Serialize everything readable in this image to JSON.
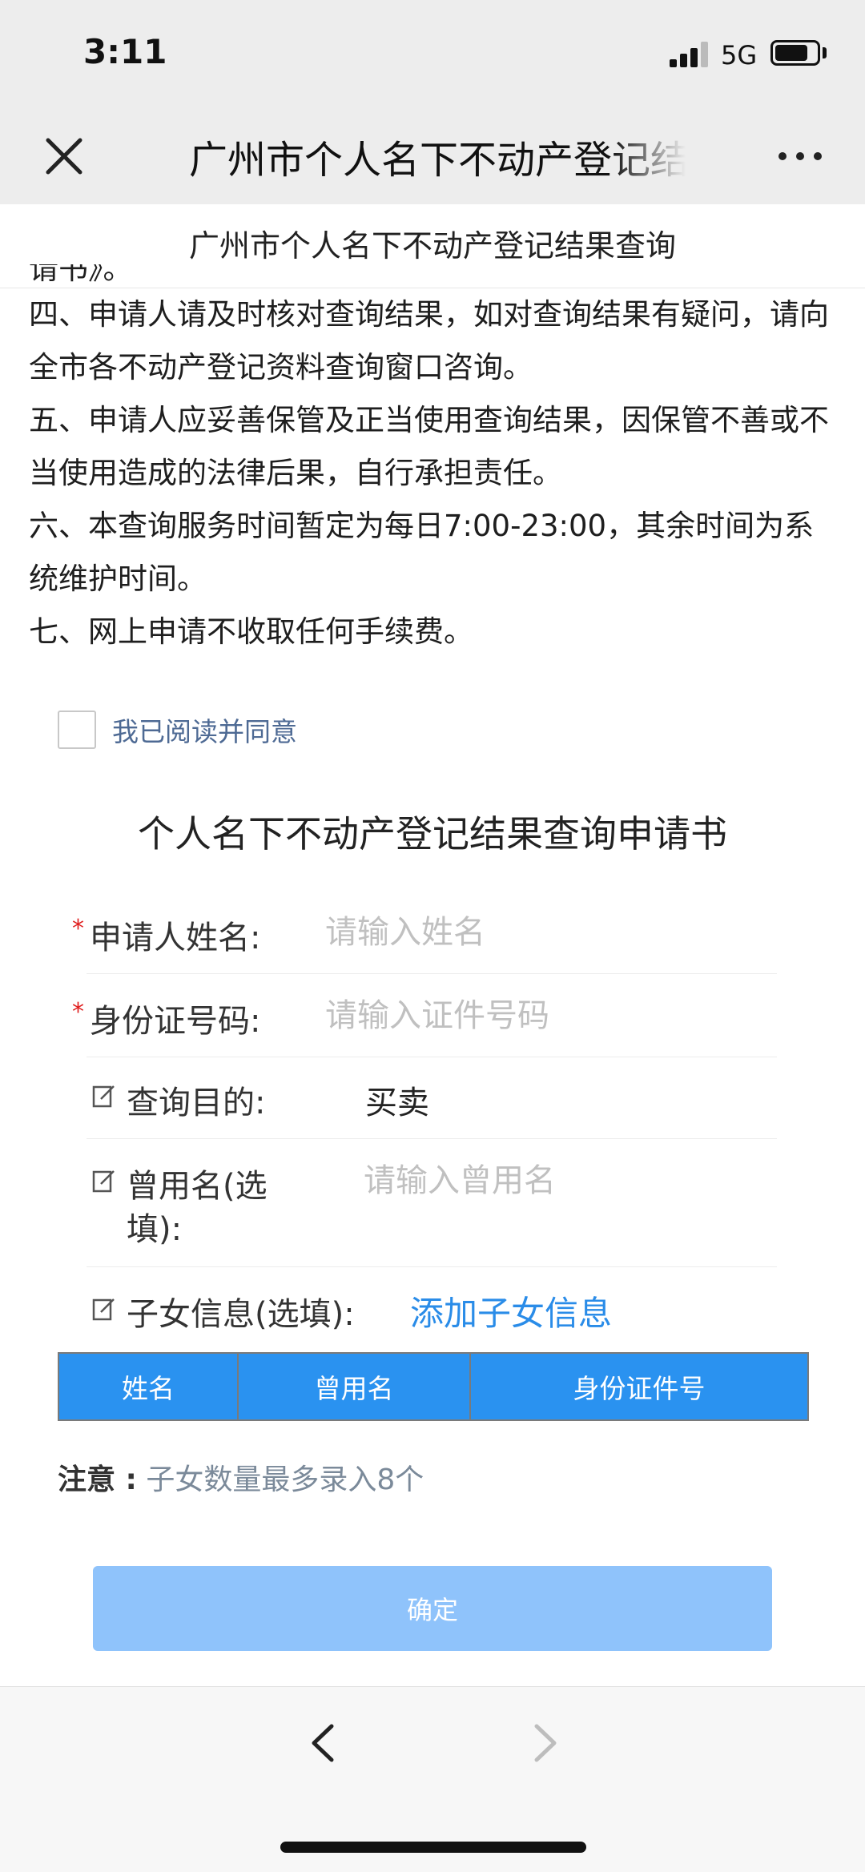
{
  "status_bar": {
    "time": "3:11",
    "network": "5G",
    "signal_level": 0.75,
    "battery_level": 0.8
  },
  "nav": {
    "close_icon": "close-icon",
    "title": "广州市个人名下不动产登记结",
    "more_icon": "more-icon"
  },
  "page_header": {
    "title": "广州市个人名下不动产登记结果查询"
  },
  "notice": {
    "cut_line": "请书》。",
    "items": [
      "四、申请人请及时核对查询结果，如对查询结果有疑问，请向全市各不动产登记资料查询窗口咨询。",
      "五、申请人应妥善保管及正当使用查询结果，因保管不善或不当使用造成的法律后果，自行承担责任。",
      "六、本查询服务时间暂定为每日7:00-23:00，其余时间为系统维护时间。",
      "七、网上申请不收取任何手续费。"
    ]
  },
  "agreement": {
    "label": "我已阅读并同意",
    "checked": false
  },
  "form": {
    "title": "个人名下不动产登记结果查询申请书",
    "required_mark": "*",
    "name": {
      "label": "申请人姓名:",
      "placeholder": "请输入姓名",
      "value": ""
    },
    "id_number": {
      "label": "身份证号码:",
      "placeholder": "请输入证件号码",
      "value": ""
    },
    "purpose": {
      "label": "查询目的:",
      "value": "买卖"
    },
    "former_name": {
      "label_line1": "曾用名(选",
      "label_line2": "填):",
      "placeholder": "请输入曾用名",
      "value": ""
    },
    "children": {
      "label": "子女信息(选填):",
      "add_link": "添加子女信息"
    }
  },
  "children_table": {
    "columns": [
      "姓名",
      "曾用名",
      "身份证件号"
    ]
  },
  "note": {
    "label": "注意 :",
    "text": "子女数量最多录入8个"
  },
  "confirm_button": {
    "label": "确定"
  },
  "bottom_nav": {
    "back_icon": "chevron-left-icon",
    "forward_icon": "chevron-right-icon"
  },
  "colors": {
    "accent": "#2a92f0",
    "link": "#2a8ce8",
    "button_disabled": "#8fc3fb",
    "required": "#e02020",
    "agree_text": "#4e6a94"
  }
}
